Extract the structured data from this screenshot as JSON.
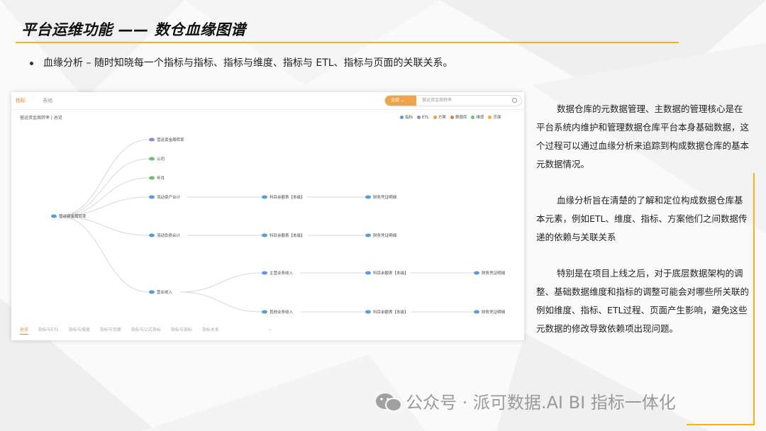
{
  "slide": {
    "title": "平台运维功能 —— 数仓血缘图谱",
    "bullet": "血缘分析 – 随时知晓每一个指标与指标、指标与维度、指标与 ETL、指标与页面的关联关系。"
  },
  "app": {
    "tabs": [
      "指标",
      "表格"
    ],
    "search": {
      "scope": "全部",
      "placeholder": "营运资金周转率"
    },
    "breadcrumb": "营运资金周转率 | 总览",
    "legend": [
      {
        "label": "指标",
        "color": "#5b9bd5"
      },
      {
        "label": "ETL",
        "color": "#9b7fd1"
      },
      {
        "label": "方案",
        "color": "#e8a23a"
      },
      {
        "label": "数据库",
        "color": "#c4853c"
      },
      {
        "label": "维度",
        "color": "#6cbf6c"
      },
      {
        "label": "页面",
        "color": "#f2b417"
      }
    ],
    "graph": {
      "root": "营运资金周转率",
      "col1": [
        "营运资金周转率",
        "公司",
        "年月",
        "流动资产合计",
        "流动负债合计",
        "营业收入"
      ],
      "col2": [
        "科目余额表【本级】",
        "科目余额表【本级】",
        "主营业务收入",
        "其他业务收入"
      ],
      "col3": [
        "财务凭证明细",
        "财务凭证明细",
        "科目余额表【本级】",
        "科目余额表【本级】"
      ],
      "col4": [
        "财务凭证明细",
        "财务凭证明细"
      ]
    },
    "bottom_tabs": [
      "总览",
      "指标与ETL",
      "指标与维度",
      "指标与页面",
      "指标与公式指标",
      "指标与指标",
      "指标关系"
    ]
  },
  "side_text": [
    "数据仓库的元数据管理、主数据的管理核心是在平台系统内维护和管理数据仓库平台本身基础数据，这个过程可以通过血缘分析来追踪到构成数据仓库的基本元数据情况。",
    "血缘分析旨在清楚的了解和定位构成数据仓库基本元素，例如ETL、维度、指标、方案他们之间数据传递的依赖与关联关系",
    "特别是在项目上线之后，对于底层数据架构的调整、基础数据维度和指标的调整可能会对哪些所关联的例如维度、指标、ETL过程、页面产生影响，避免这些元数据的修改导致依赖项出现问题。"
  ],
  "watermark": "公众号 · 派可数据.AI BI 指标一体化",
  "colors": {
    "accent": "#f2b417",
    "search_scope": "#f0a44a",
    "active_tab": "#e8823a"
  }
}
